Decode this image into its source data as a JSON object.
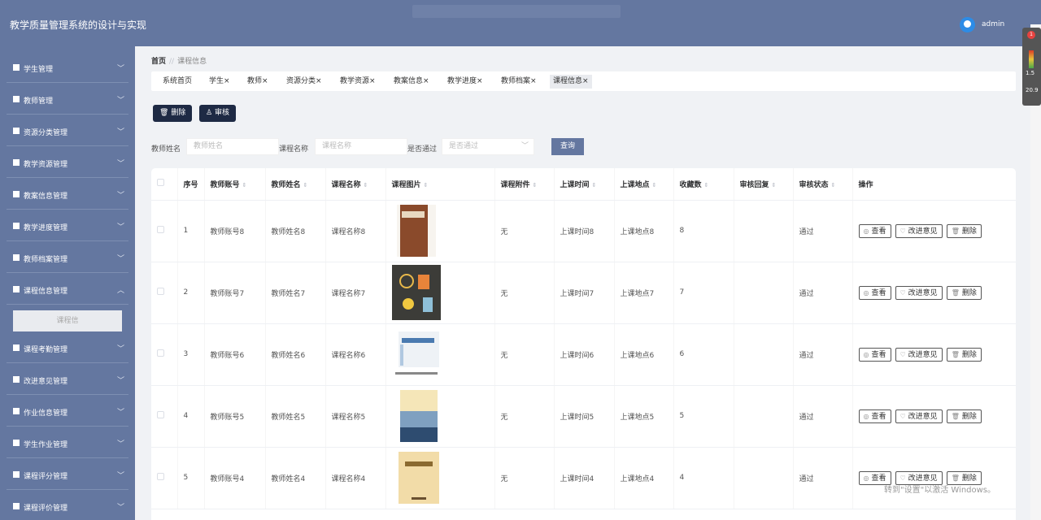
{
  "header": {
    "title": "教学质量管理系统的设计与实现",
    "username": "admin"
  },
  "sidebar": {
    "items": [
      {
        "label": "学生管理"
      },
      {
        "label": "教师管理"
      },
      {
        "label": "资源分类管理"
      },
      {
        "label": "教学资源管理"
      },
      {
        "label": "教案信息管理"
      },
      {
        "label": "教学进度管理"
      },
      {
        "label": "教师档案管理"
      },
      {
        "label": "课程信息管理",
        "expanded": true,
        "sub": "课程信"
      },
      {
        "label": "课程考勤管理"
      },
      {
        "label": "改进意见管理"
      },
      {
        "label": "作业信息管理"
      },
      {
        "label": "学生作业管理"
      },
      {
        "label": "课程评分管理"
      },
      {
        "label": "课程评价管理"
      }
    ]
  },
  "breadcrumb": {
    "home": "首页",
    "sep": "//",
    "current": "课程信息"
  },
  "tabs": [
    {
      "label": "系统首页"
    },
    {
      "label": "学生"
    },
    {
      "label": "教师"
    },
    {
      "label": "资源分类"
    },
    {
      "label": "教学资源"
    },
    {
      "label": "教案信息"
    },
    {
      "label": "教学进度"
    },
    {
      "label": "教师档案"
    },
    {
      "label": "课程信息",
      "active": true
    }
  ],
  "toolbar": {
    "delete_label": "删除",
    "audit_label": "审核"
  },
  "filters": {
    "teacher_name_label": "教师姓名",
    "teacher_name_placeholder": "教师姓名",
    "course_name_label": "课程名称",
    "course_name_placeholder": "课程名称",
    "passed_label": "是否通过",
    "passed_placeholder": "是否通过",
    "query_label": "查询"
  },
  "table": {
    "headers": [
      "序号",
      "教师账号",
      "教师姓名",
      "课程名称",
      "课程图片",
      "课程附件",
      "上课时间",
      "上课地点",
      "收藏数",
      "审核回复",
      "审核状态",
      "操作"
    ],
    "rows": [
      {
        "idx": "1",
        "account": "教师账号8",
        "name": "教师姓名8",
        "course": "课程名称8",
        "attach": "无",
        "time": "上课时间8",
        "place": "上课地点8",
        "favs": "8",
        "reply": "",
        "status": "通过"
      },
      {
        "idx": "2",
        "account": "教师账号7",
        "name": "教师姓名7",
        "course": "课程名称7",
        "attach": "无",
        "time": "上课时间7",
        "place": "上课地点7",
        "favs": "7",
        "reply": "",
        "status": "通过"
      },
      {
        "idx": "3",
        "account": "教师账号6",
        "name": "教师姓名6",
        "course": "课程名称6",
        "attach": "无",
        "time": "上课时间6",
        "place": "上课地点6",
        "favs": "6",
        "reply": "",
        "status": "通过"
      },
      {
        "idx": "4",
        "account": "教师账号5",
        "name": "教师姓名5",
        "course": "课程名称5",
        "attach": "无",
        "time": "上课时间5",
        "place": "上课地点5",
        "favs": "5",
        "reply": "",
        "status": "通过"
      },
      {
        "idx": "5",
        "account": "教师账号4",
        "name": "教师姓名4",
        "course": "课程名称4",
        "attach": "无",
        "time": "上课时间4",
        "place": "上课地点4",
        "favs": "4",
        "reply": "",
        "status": "通过"
      }
    ],
    "actions": {
      "view": "查看",
      "improve": "改进意见",
      "delete": "删除"
    }
  },
  "widget": {
    "badge": "1",
    "a": "1.5",
    "b": "20.9"
  },
  "watermark": {
    "line1": "转到\"设置\"以激活 Windows。"
  },
  "colors": {
    "header_bg": "#6477a0",
    "button_dark": "#1e2a44",
    "query_button": "#6477a0"
  }
}
